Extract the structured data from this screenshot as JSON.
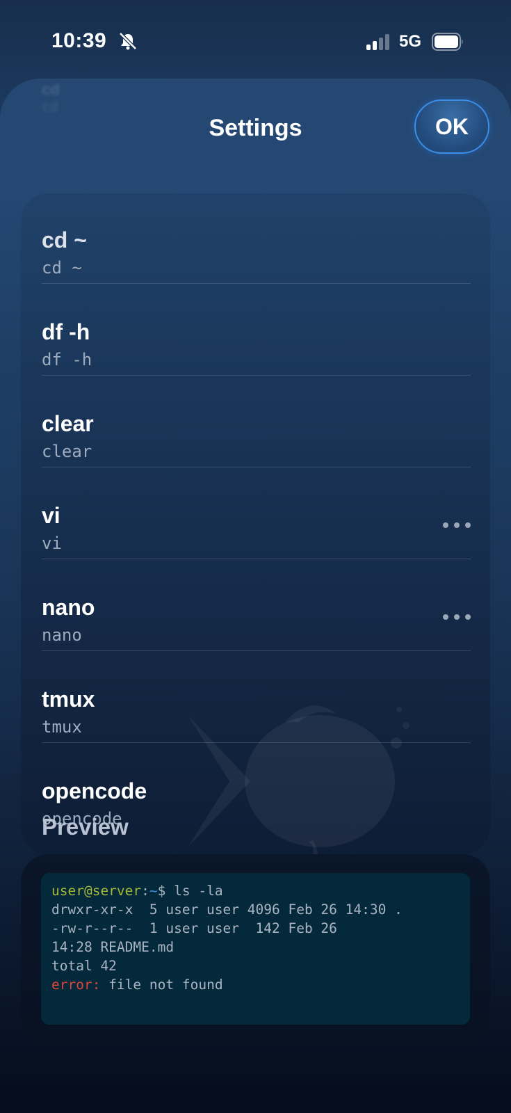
{
  "status_bar": {
    "time": "10:39",
    "network": "5G",
    "icons": [
      "bell-slash-icon",
      "cellular-signal-icon",
      "battery-icon"
    ]
  },
  "sheet": {
    "title": "Settings",
    "ok_label": "OK",
    "ghost_title": "cd",
    "ghost_sub": "cd"
  },
  "commands": [
    {
      "title": "cd ~",
      "command": "cd ~",
      "has_more": false
    },
    {
      "title": "df -h",
      "command": "df -h",
      "has_more": false
    },
    {
      "title": "clear",
      "command": "clear",
      "has_more": false
    },
    {
      "title": "vi",
      "command": "vi",
      "has_more": true
    },
    {
      "title": "nano",
      "command": "nano",
      "has_more": true
    },
    {
      "title": "tmux",
      "command": "tmux",
      "has_more": false
    },
    {
      "title": "opencode",
      "command": "opencode",
      "has_more": false
    }
  ],
  "preview": {
    "label": "Preview",
    "prompt_user": "user@server",
    "prompt_sep": ":",
    "prompt_path": "~",
    "prompt_cmd": "$ ls -la",
    "line1": "drwxr-xr-x  5 user user 4096 Feb 26 14:30 .",
    "line2": "-rw-r--r--  1 user user  142 Feb 26",
    "line3": "14:28 README.md",
    "line4": "total 42",
    "error_label": "error:",
    "error_text": " file not found"
  },
  "colors": {
    "accent": "#3b8de6",
    "prompt_user": "#a7b83a",
    "prompt_path": "#3e8ee6",
    "error": "#e2453c",
    "terminal_bg": "#03293a"
  }
}
